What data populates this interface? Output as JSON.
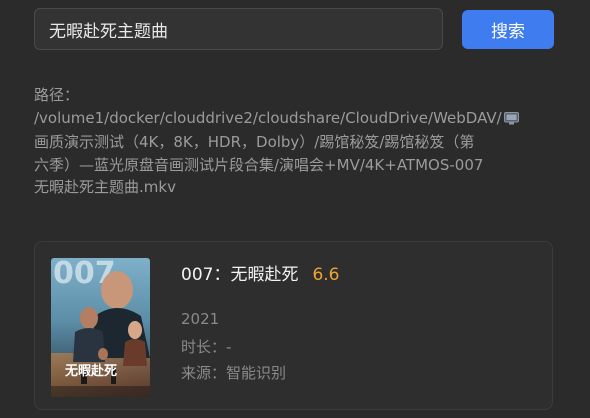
{
  "search": {
    "value": "无暇赴死主题曲",
    "button_label": "搜索"
  },
  "path": {
    "label": "路径：",
    "lines": [
      "/volume1/docker/clouddrive2/cloudshare/CloudDrive/WebDAV/",
      "画质演示测试（4K，8K，HDR，Dolby）/踢馆秘笈/踢馆秘笈（第",
      "六季）—蓝光原盘音画测试片段合集/演唱会+MV/4K+ATMOS-007",
      "无暇赴死主题曲.mkv"
    ]
  },
  "result": {
    "title": "007：无暇赴死",
    "rating": "6.6",
    "year": "2021",
    "duration": "时长：-",
    "source": "来源：智能识别",
    "poster_text": "无暇赴死",
    "poster_logo": "007"
  },
  "colors": {
    "accent": "#3f7cf0",
    "rating": "#f0a332"
  }
}
